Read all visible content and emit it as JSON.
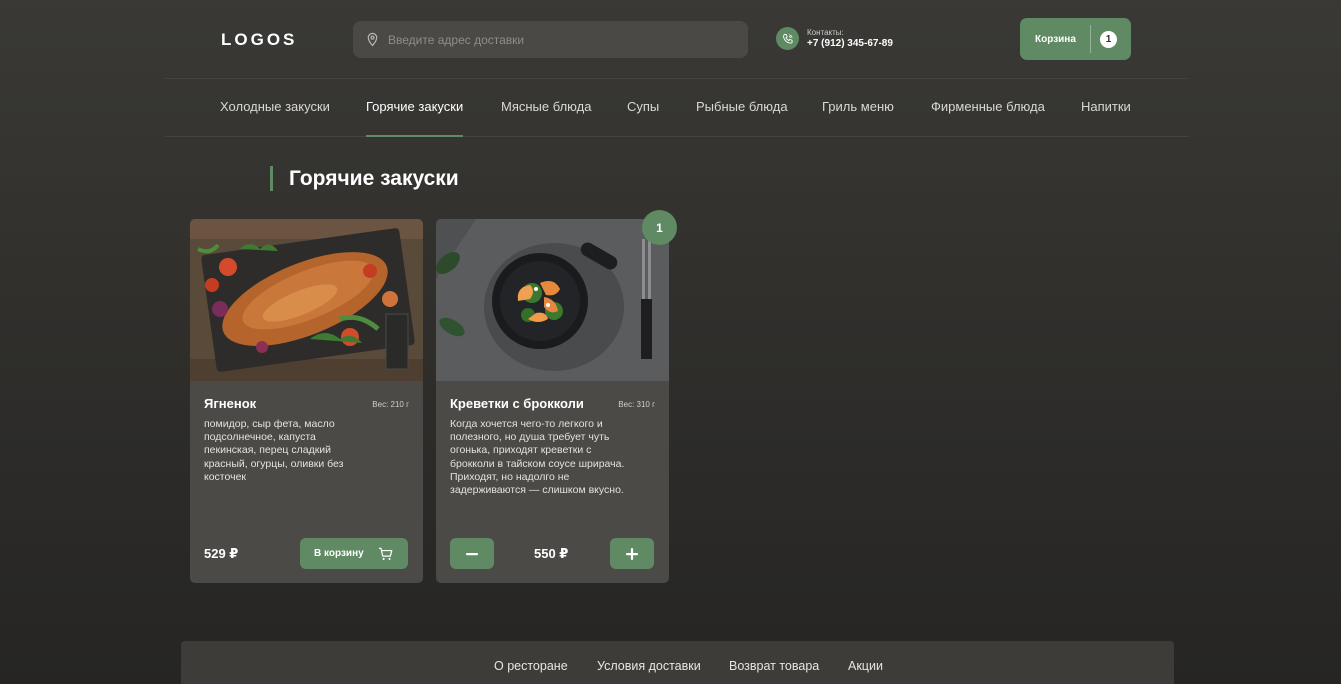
{
  "header": {
    "logo": "LOGOS",
    "search_placeholder": "Введите адрес доставки",
    "contacts_label": "Контакты:",
    "contacts_phone": "+7 (912) 345-67-89",
    "cart_label": "Корзина",
    "cart_count": "1"
  },
  "nav": {
    "items": [
      {
        "label": "Холодные закуски"
      },
      {
        "label": "Горячие закуски"
      },
      {
        "label": "Мясные блюда"
      },
      {
        "label": "Супы"
      },
      {
        "label": "Рыбные блюда"
      },
      {
        "label": "Гриль меню"
      },
      {
        "label": "Фирменные блюда"
      },
      {
        "label": "Напитки"
      }
    ],
    "active_index": 1
  },
  "page_title": "Горячие закуски",
  "products": [
    {
      "name": "Ягненок",
      "weight": "Вес: 210 г",
      "description": "помидор, сыр фета, масло подсолнечное, капуста пекинская, перец сладкий красный, огурцы, оливки без косточек",
      "price": "529 ₽",
      "add_label": "В корзину"
    },
    {
      "name": "Креветки с брокколи",
      "weight": "Вес: 310 г",
      "description": "Когда хочется чего-то легкого и полезного, но душа требует чуть огонька, приходят креветки с брокколи в тайском соусе шрирача. Приходят, но надолго не задерживаются — слишком вкусно.",
      "price": "550 ₽",
      "in_cart_count": "1"
    }
  ],
  "footer": {
    "links": [
      {
        "label": "О ресторане"
      },
      {
        "label": "Условия доставки"
      },
      {
        "label": "Возврат товара"
      },
      {
        "label": "Акции"
      }
    ]
  },
  "colors": {
    "accent": "#5f8a63",
    "card": "#4b4a47",
    "background": "#33322f"
  },
  "icons": [
    "location-pin-icon",
    "phone-icon",
    "cart-icon",
    "minus-icon",
    "plus-icon"
  ]
}
